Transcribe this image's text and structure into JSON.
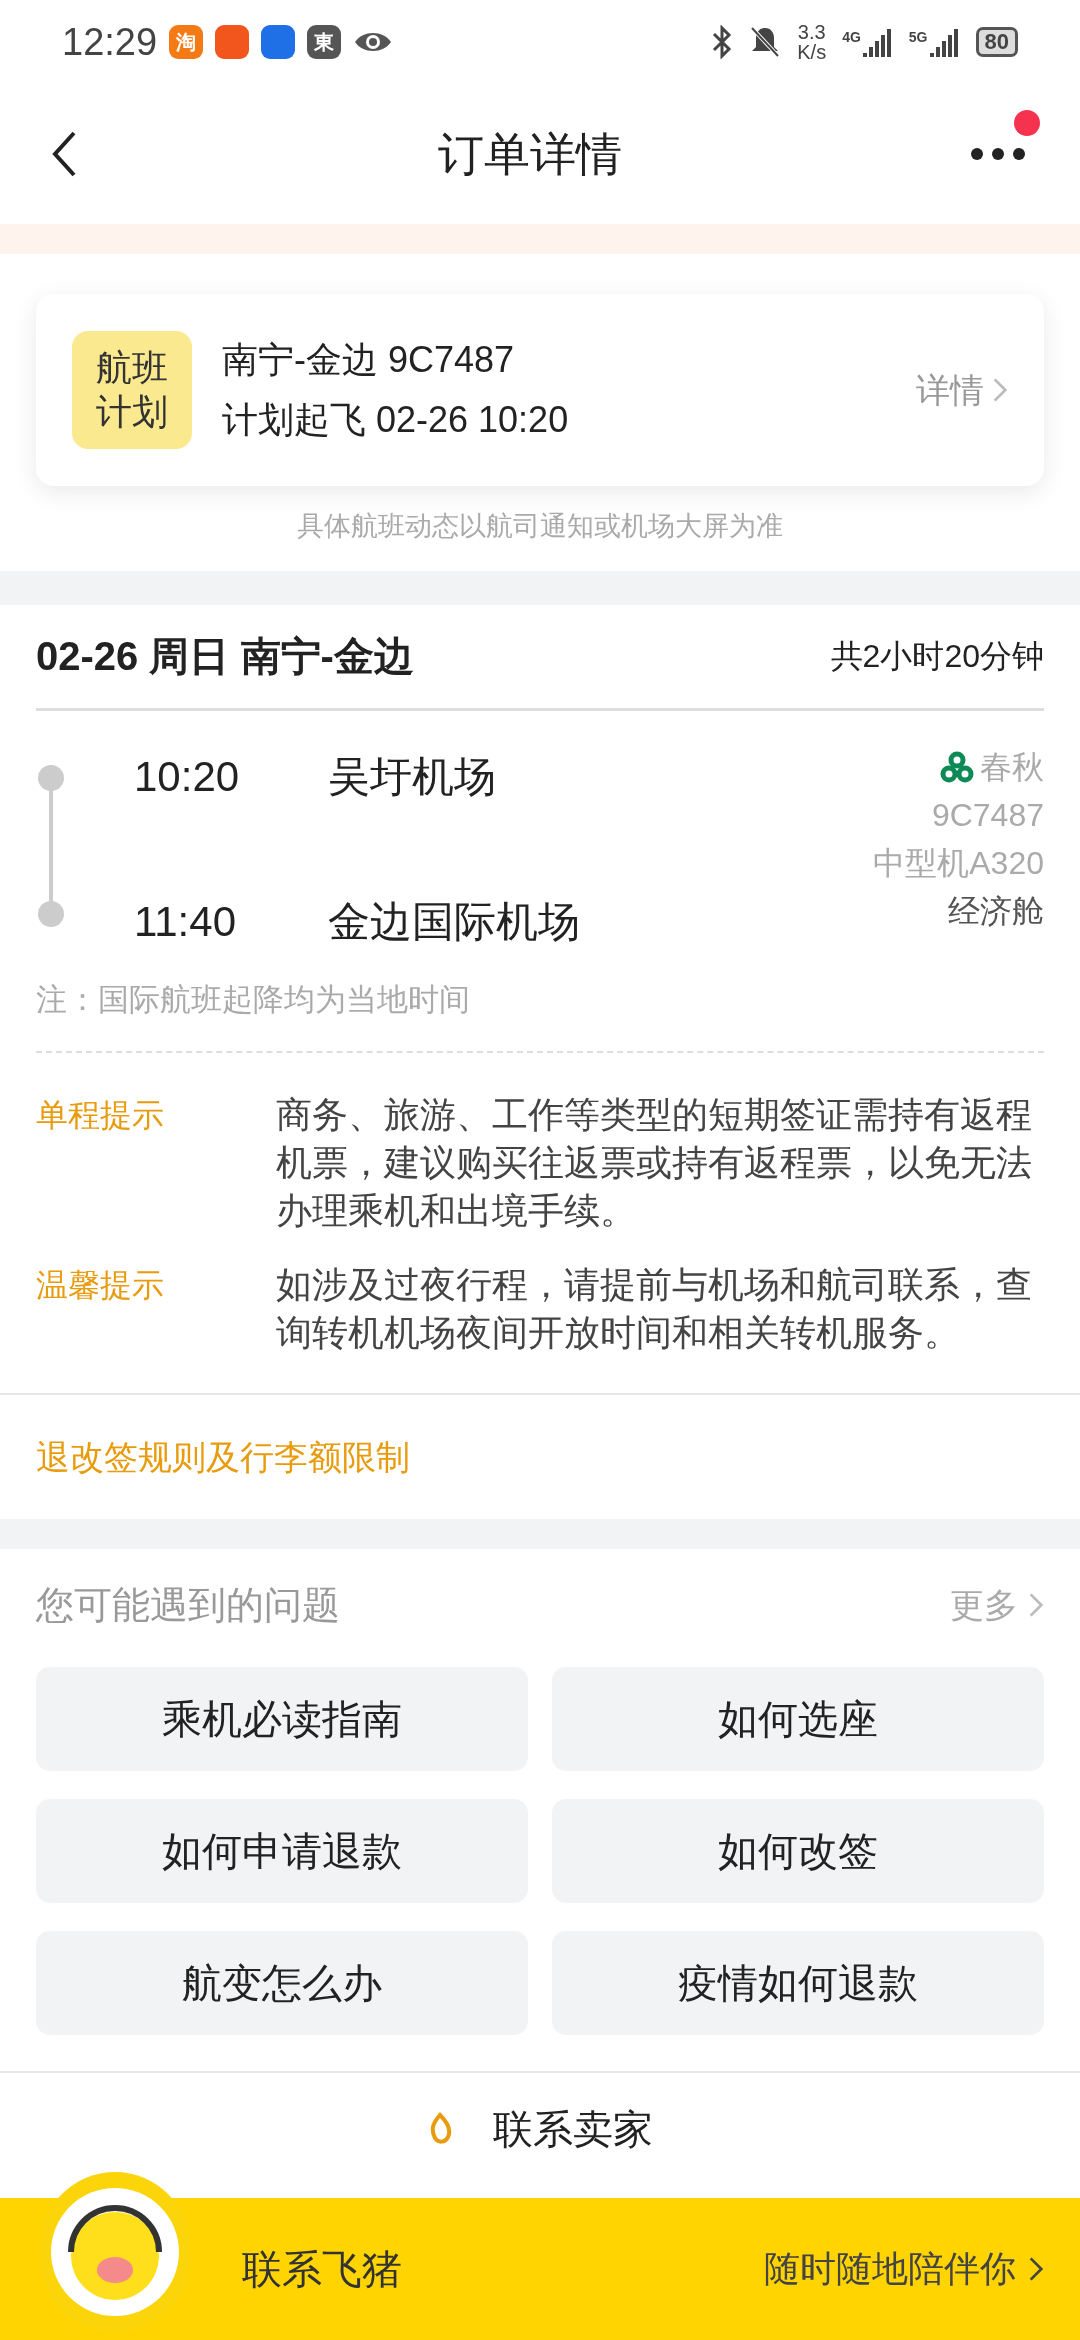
{
  "status_bar": {
    "time": "12:29",
    "app_icons": [
      {
        "label": "淘",
        "color": "#f47a16"
      },
      {
        "color": "#f2561d"
      },
      {
        "color": "#1f6fe6"
      },
      {
        "label": "東",
        "color": "#555555"
      }
    ],
    "speed_value": "3.3",
    "speed_unit": "K/s",
    "network_1": "4G",
    "network_2": "5G",
    "battery": "80"
  },
  "header": {
    "title": "订单详情",
    "notification_dot": true
  },
  "flight_card": {
    "badge": "航班计划",
    "route": "南宁-金边 9C7487",
    "departure": "计划起飞 02-26 10:20",
    "details_link": "详情",
    "note": "具体航班动态以航司通知或机场大屏为准"
  },
  "itinerary": {
    "title": "02-26 周日 南宁-金边",
    "duration": "共2小时20分钟",
    "stops": [
      {
        "time": "10:20",
        "airport": "吴圩机场"
      },
      {
        "time": "11:40",
        "airport": "金边国际机场"
      }
    ],
    "airline": "春秋",
    "flight_no": "9C7487",
    "aircraft": "中型机A320",
    "cabin": "经济舱",
    "note": "注：国际航班起降均为当地时间"
  },
  "tips": [
    {
      "label": "单程提示",
      "text": "商务、旅游、工作等类型的短期签证需持有返程机票，建议购买往返票或持有返程票，以免无法办理乘机和出境手续。"
    },
    {
      "label": "温馨提示",
      "text": "如涉及过夜行程，请提前与机场和航司联系，查询转机机场夜间开放时间和相关转机服务。"
    }
  ],
  "rules_link": "退改签规则及行李额限制",
  "faq": {
    "title": "您可能遇到的问题",
    "more": "更多",
    "items": [
      "乘机必读指南",
      "如何选座",
      "如何申请退款",
      "如何改签",
      "航变怎么办",
      "疫情如何退款"
    ]
  },
  "contact_seller": "联系卖家",
  "bottom_bar": {
    "title": "联系飞猪",
    "subtitle": "随时随地陪伴你"
  }
}
